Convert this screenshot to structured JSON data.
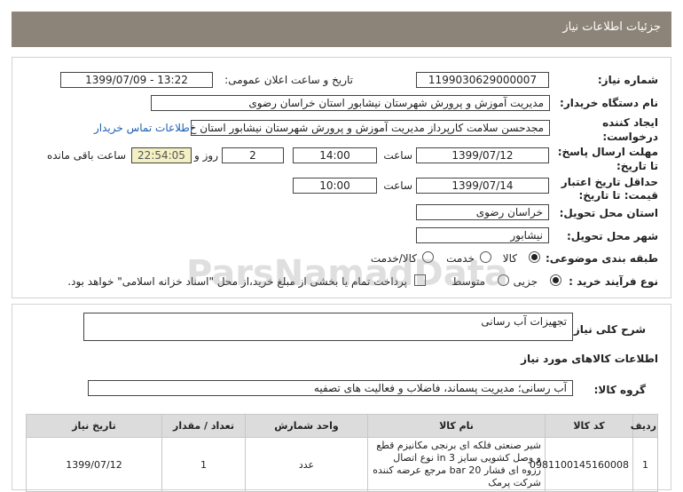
{
  "header": {
    "title": "جزئیات اطلاعات نیاز"
  },
  "details": {
    "need_number_label": "شماره نیاز:",
    "need_number": "1199030629000007",
    "announce_label": "تاریخ و ساعت اعلان عمومی:",
    "announce_value": "1399/07/09 - 13:22",
    "buyer_label": "نام دستگاه خریدار:",
    "buyer_value": "مدیریت آموزش و پرورش شهرستان نیشابور استان خراسان رضوی",
    "creator_label_1": "ایجاد کننده",
    "creator_label_2": "درخواست:",
    "creator_value": "مجدحسن سلامت کارپرداز مدیریت آموزش و پرورش شهرستان نیشابور استان خ",
    "contact_link": "اطلاعات تماس خریدار",
    "deadline_label_1": "مهلت ارسال پاسخ:",
    "deadline_label_2": "تا تاریخ:",
    "deadline_date": "1399/07/12",
    "time_label": "ساعت",
    "deadline_time": "14:00",
    "days_value": "2",
    "days_label": "روز و",
    "remaining_time": "22:54:05",
    "remaining_label": "ساعت باقی مانده",
    "validity_label_1": "حداقل تاریخ اعتبار",
    "validity_label_2": "قیمت: تا تاریخ:",
    "validity_date": "1399/07/14",
    "validity_time": "10:00",
    "province_label": "استان محل تحویل:",
    "province_value": "خراسان رضوی",
    "city_label": "شهر محل تحویل:",
    "city_value": "نیشابور",
    "category_label": "طبقه بندی موضوعی:",
    "category_options": [
      "کالا",
      "خدمت",
      "کالا/خدمت"
    ],
    "category_selected": 0,
    "process_label": "نوع فرآیند خرید :",
    "process_options": [
      "جزیی",
      "متوسط"
    ],
    "process_selected": 0,
    "payment_text": "پرداخت تمام یا بخشی از مبلغ خرید،از محل \"اسناد خزانه اسلامی\" خواهد بود."
  },
  "summary": {
    "label": "شرح کلی نیاز:",
    "value": "تجهیزات آب رسانی",
    "goods_info_title": "اطلاعات کالاهای مورد نیاز",
    "group_label": "گروه کالا:",
    "group_value": "آب رسانی؛ مدیریت پسماند، فاضلاب و فعالیت های تصفیه"
  },
  "table": {
    "headers": [
      "ردیف",
      "کد کالا",
      "نام کالا",
      "واحد شمارش",
      "تعداد / مقدار",
      "تاریخ نیاز"
    ],
    "rows": [
      {
        "row": "1",
        "code": "0981100145160008",
        "name": "شیر صنعتی فلکه ای برنجی مکانیزم قطع و وصل کشویی سایز 3 in نوع اتصال رزوه ای فشار 20 bar مرجع عرضه کننده شرکت پرمک",
        "unit": "عدد",
        "qty": "1",
        "date": "1399/07/12"
      }
    ]
  },
  "watermark": {
    "brand": "ParsNamadData"
  },
  "colors": {
    "header_bg": "#8c8478",
    "link": "#1d5fb4",
    "yellow_field": "#f3f0c4"
  }
}
